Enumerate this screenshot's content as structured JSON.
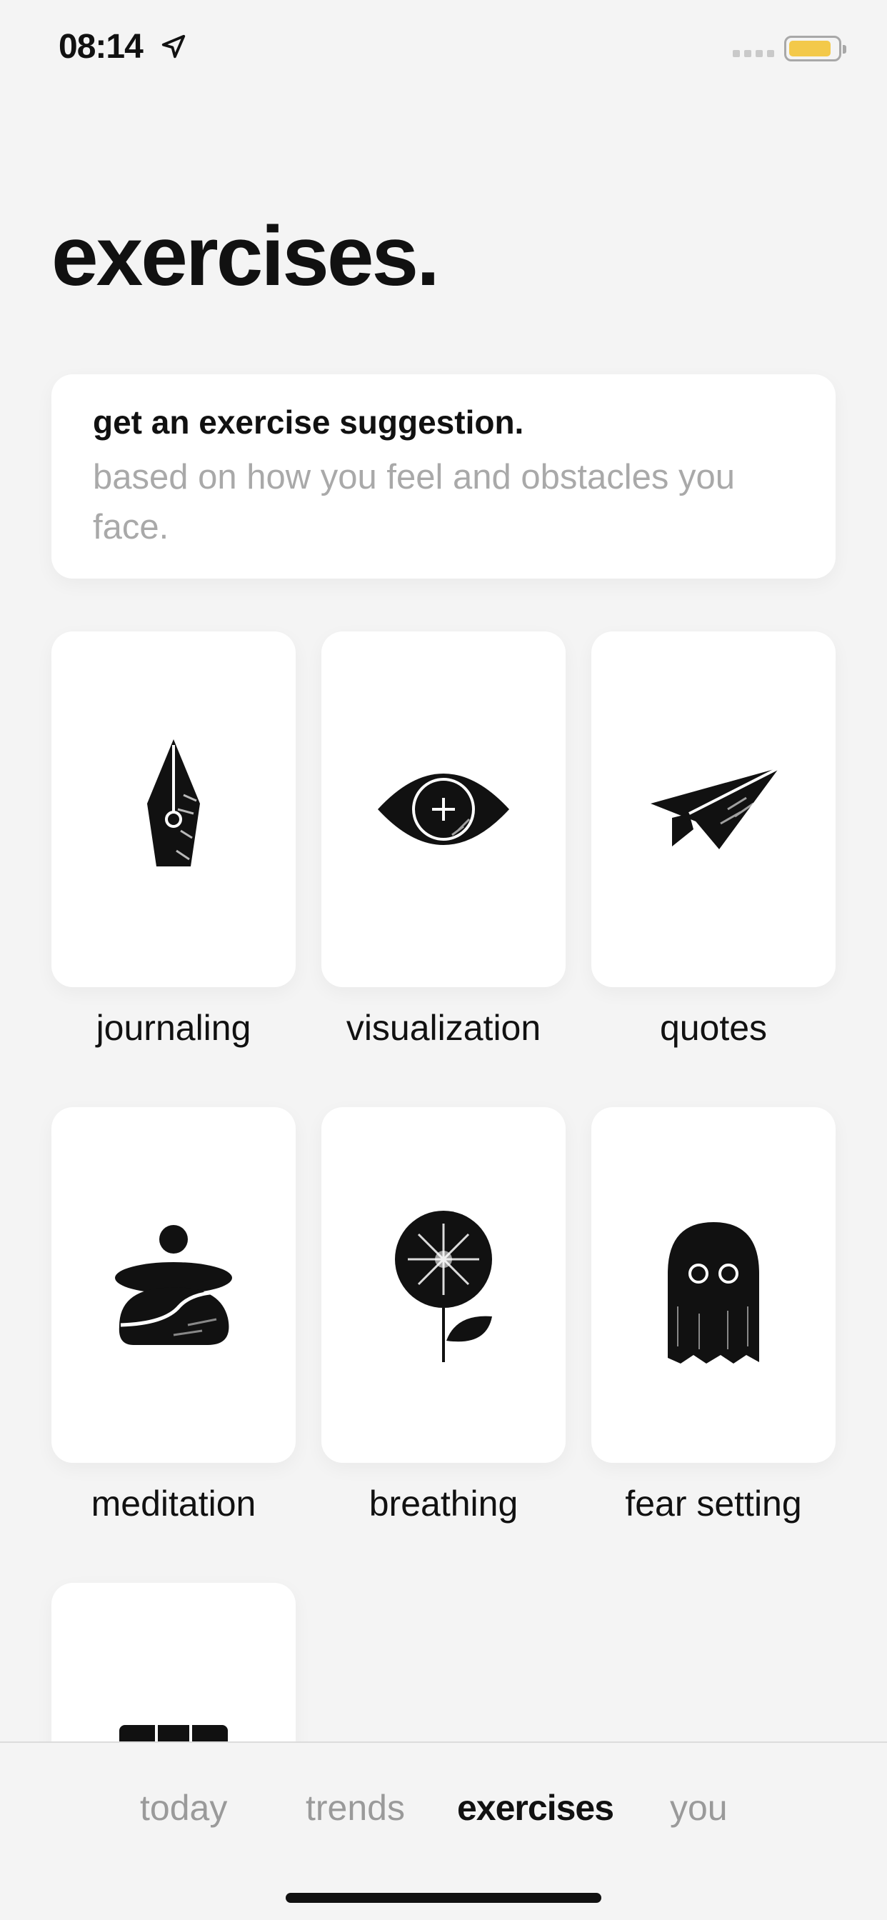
{
  "status_bar": {
    "time": "08:14",
    "battery_color": "#f3c94a"
  },
  "page": {
    "title": "exercises."
  },
  "suggestion": {
    "title": "get an exercise suggestion.",
    "subtitle": "based on how you feel and obstacles you face."
  },
  "exercises": [
    {
      "label": "journaling",
      "icon": "pen-nib-icon"
    },
    {
      "label": "visualization",
      "icon": "eye-icon"
    },
    {
      "label": "quotes",
      "icon": "paper-plane-icon"
    },
    {
      "label": "meditation",
      "icon": "stacked-stones-icon"
    },
    {
      "label": "breathing",
      "icon": "dandelion-flower-icon"
    },
    {
      "label": "fear setting",
      "icon": "ghost-icon"
    },
    {
      "label": "",
      "icon": "box-x-icon"
    }
  ],
  "tab_bar": {
    "tabs": [
      {
        "label": "today",
        "active": false
      },
      {
        "label": "trends",
        "active": false
      },
      {
        "label": "exercises",
        "active": true
      },
      {
        "label": "you",
        "active": false
      }
    ]
  }
}
